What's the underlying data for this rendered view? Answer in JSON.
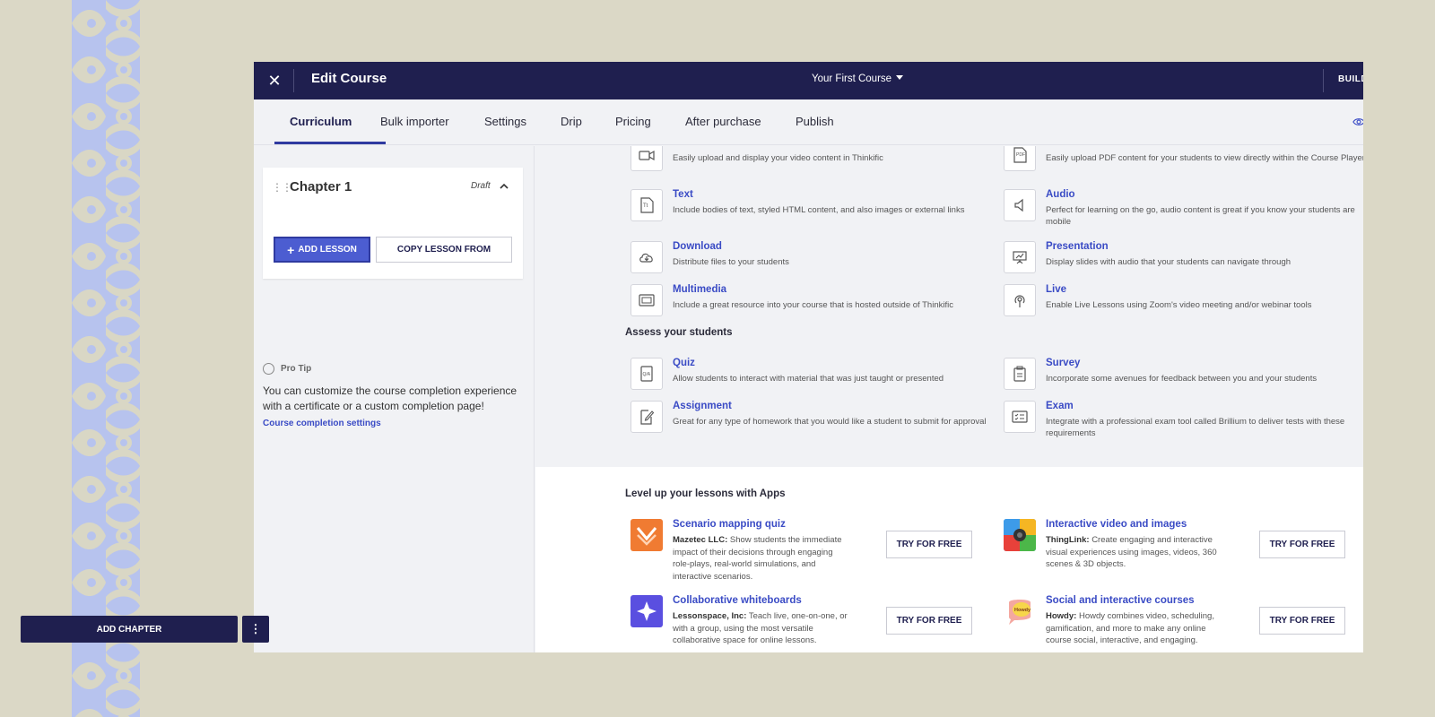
{
  "header": {
    "title": "Edit Course",
    "course_selector": "Your First Course",
    "right_label": "BUILD"
  },
  "tabs": [
    "Curriculum",
    "Bulk importer",
    "Settings",
    "Drip",
    "Pricing",
    "After purchase",
    "Publish"
  ],
  "active_tab": "Curriculum",
  "sidebar": {
    "chapter_title": "Chapter 1",
    "chapter_status": "Draft",
    "add_lesson": "ADD LESSON",
    "copy_lesson": "COPY LESSON FROM",
    "protip_label": "Pro Tip",
    "protip_text": "You can customize the course completion experience with a certificate or a custom completion page!",
    "protip_link": "Course completion settings",
    "add_chapter": "ADD CHAPTER",
    "more_glyph": "⋮"
  },
  "lesson_types": {
    "video_desc": "Easily upload and display your video content in Thinkific",
    "pdf_desc": "Easily upload PDF content for your students to view directly within the Course Player",
    "items": [
      {
        "name": "Text",
        "desc": "Include bodies of text, styled HTML content, and also images or external links",
        "icon": "text-icon"
      },
      {
        "name": "Audio",
        "desc": "Perfect for learning on the go, audio content is great if you know your students are mobile",
        "icon": "speaker-icon"
      },
      {
        "name": "Download",
        "desc": "Distribute files to your students",
        "icon": "cloud-download-icon"
      },
      {
        "name": "Presentation",
        "desc": "Display slides with audio that your students can navigate through",
        "icon": "presentation-icon"
      },
      {
        "name": "Multimedia",
        "desc": "Include a great resource into your course that is hosted outside of Thinkific",
        "icon": "multimedia-icon"
      },
      {
        "name": "Live",
        "desc": "Enable Live Lessons using Zoom's video meeting and/or webinar tools",
        "icon": "broadcast-icon"
      }
    ]
  },
  "assess": {
    "heading": "Assess your students",
    "items": [
      {
        "name": "Quiz",
        "desc": "Allow students to interact with material that was just taught or presented",
        "icon": "quiz-icon"
      },
      {
        "name": "Survey",
        "desc": "Incorporate some avenues for feedback between you and your students",
        "icon": "clipboard-icon"
      },
      {
        "name": "Assignment",
        "desc": "Great for any type of homework that you would like a student to submit for approval",
        "icon": "pencil-doc-icon"
      },
      {
        "name": "Exam",
        "desc": "Integrate with a professional exam tool called Brillium to deliver tests with these requirements",
        "icon": "exam-icon"
      }
    ]
  },
  "apps": {
    "heading": "Level up your lessons with Apps",
    "try_label": "TRY FOR FREE",
    "items": [
      {
        "name": "Scenario mapping quiz",
        "vendor": "Mazetec LLC:",
        "desc": "Show students the immediate impact of their decisions through engaging role-plays, real-world simulations, and interactive scenarios.",
        "color": "#f07b32"
      },
      {
        "name": "Interactive video and images",
        "vendor": "ThingLink:",
        "desc": "Create engaging and interactive visual experiences using images, videos, 360 scenes & 3D objects.",
        "color": "#3d9be9"
      },
      {
        "name": "Collaborative whiteboards",
        "vendor": "Lessonspace, Inc:",
        "desc": "Teach live, one-on-one, or with a group, using the most versatile collaborative space for online lessons.",
        "color": "#5a4fe0"
      },
      {
        "name": "Social and interactive courses",
        "vendor": "Howdy:",
        "desc": "Howdy combines video, scheduling, gamification, and more to make any online course social, interactive, and engaging.",
        "color": "#f4a8a0",
        "logo_text": "Howdy"
      }
    ]
  },
  "colors": {
    "navy": "#1f1f4f",
    "accent": "#3a4bc5",
    "button_primary": "#4c5dd1",
    "background": "#dbd8c6"
  }
}
